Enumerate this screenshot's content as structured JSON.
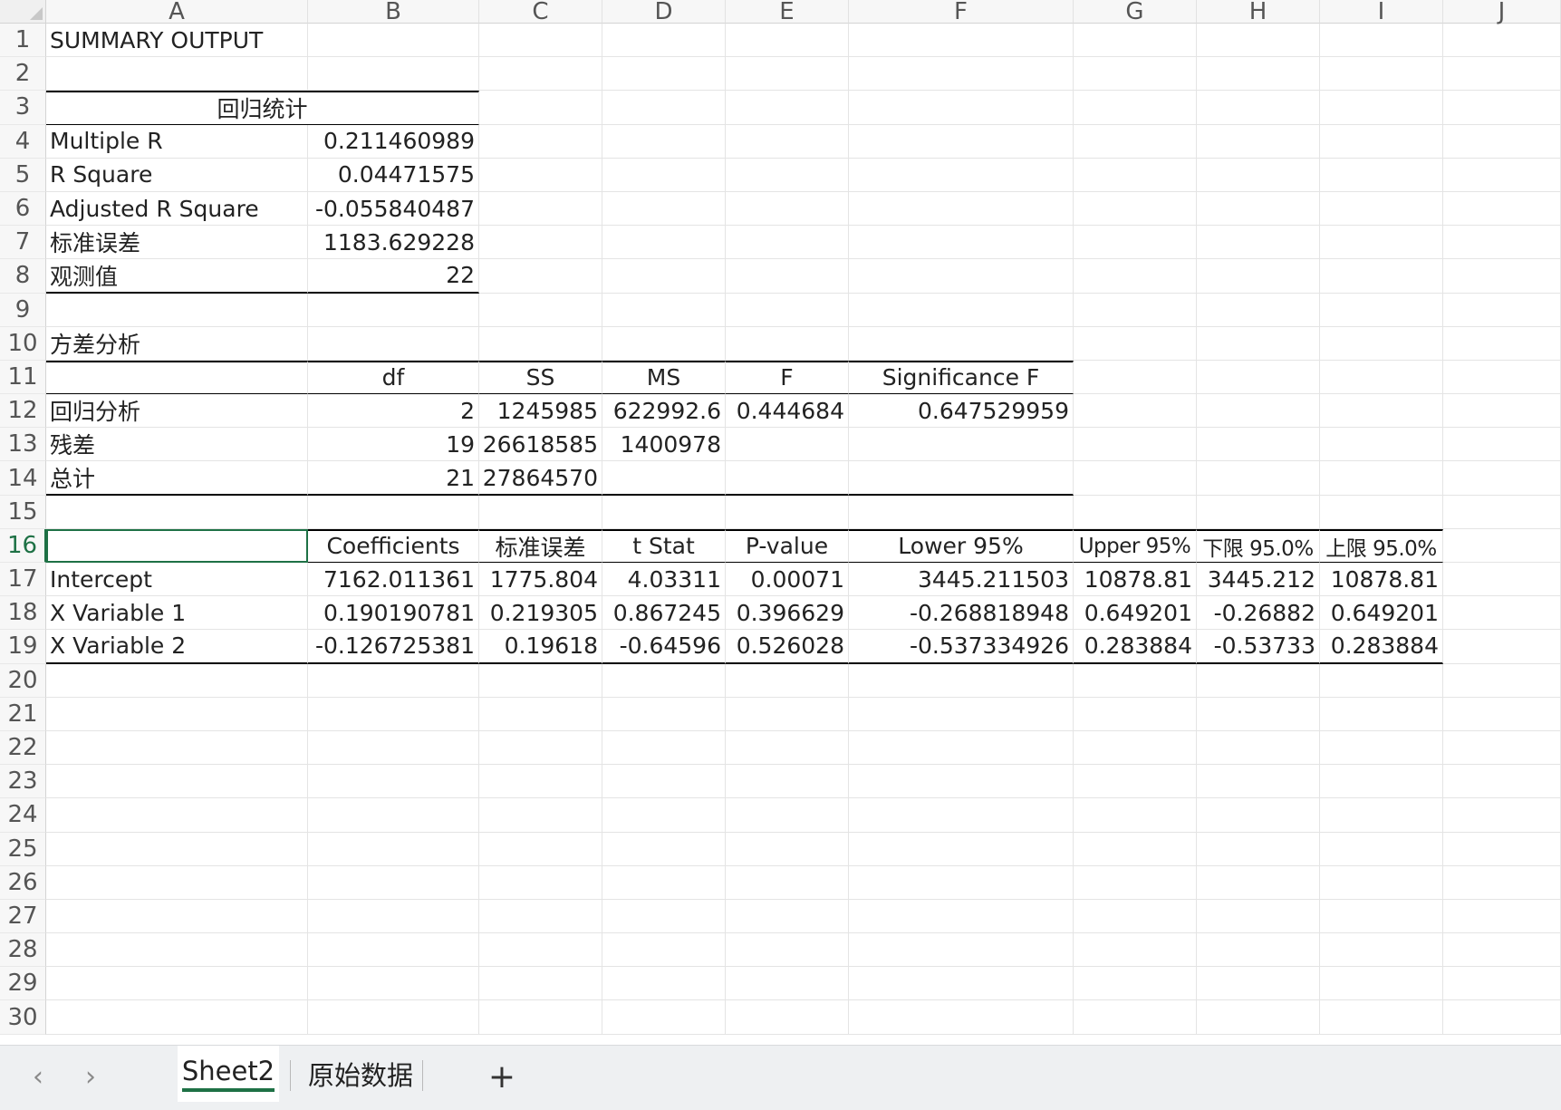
{
  "columns": [
    "A",
    "B",
    "C",
    "D",
    "E",
    "F",
    "G",
    "H",
    "I",
    "J"
  ],
  "rows": [
    "1",
    "2",
    "3",
    "4",
    "5",
    "6",
    "7",
    "8",
    "9",
    "10",
    "11",
    "12",
    "13",
    "14",
    "15",
    "16",
    "17",
    "18",
    "19",
    "20",
    "21",
    "22",
    "23",
    "24",
    "25",
    "26",
    "27",
    "28",
    "29",
    "30"
  ],
  "active_row": "16",
  "cells": {
    "A1": "SUMMARY OUTPUT",
    "A3": "回归统计",
    "A4": "Multiple R",
    "B4": "0.211460989",
    "A5": "R Square",
    "B5": "0.04471575",
    "A6": "Adjusted R Square",
    "B6": "-0.055840487",
    "A7": "标准误差",
    "B7": "1183.629228",
    "A8": "观测值",
    "B8": "22",
    "A10": "方差分析",
    "B11": "df",
    "C11": "SS",
    "D11": "MS",
    "E11": "F",
    "F11": "Significance F",
    "A12": "回归分析",
    "B12": "2",
    "C12": "1245985",
    "D12": "622992.6",
    "E12": "0.444684",
    "F12": "0.647529959",
    "A13": "残差",
    "B13": "19",
    "C13": "26618585",
    "D13": "1400978",
    "A14": "总计",
    "B14": "21",
    "C14": "27864570",
    "B16": "Coefficients",
    "C16": "标准误差",
    "D16": "t Stat",
    "E16": "P-value",
    "F16": "Lower 95%",
    "G16": "Upper 95%",
    "H16": "下限 95.0%",
    "I16": "上限 95.0%",
    "A17": "Intercept",
    "B17": "7162.011361",
    "C17": "1775.804",
    "D17": "4.03311",
    "E17": "0.00071",
    "F17": "3445.211503",
    "G17": "10878.81",
    "H17": "3445.212",
    "I17": "10878.81",
    "A18": "X Variable 1",
    "B18": "0.190190781",
    "C18": "0.219305",
    "D18": "0.867245",
    "E18": "0.396629",
    "F18": "-0.268818948",
    "G18": "0.649201",
    "H18": "-0.26882",
    "I18": "0.649201",
    "A19": "X Variable 2",
    "B19": "-0.126725381",
    "C19": "0.19618",
    "D19": "-0.64596",
    "E19": "0.526028",
    "F19": "-0.537334926",
    "G19": "0.283884",
    "H19": "-0.53733",
    "I19": "0.283884"
  },
  "tabs": {
    "prev_icon": "chevron-left-icon",
    "next_icon": "chevron-right-icon",
    "sheets": [
      "Sheet2",
      "原始数据"
    ],
    "active": "Sheet2",
    "add_icon": "plus-icon"
  },
  "colors": {
    "accent": "#1e7145"
  }
}
